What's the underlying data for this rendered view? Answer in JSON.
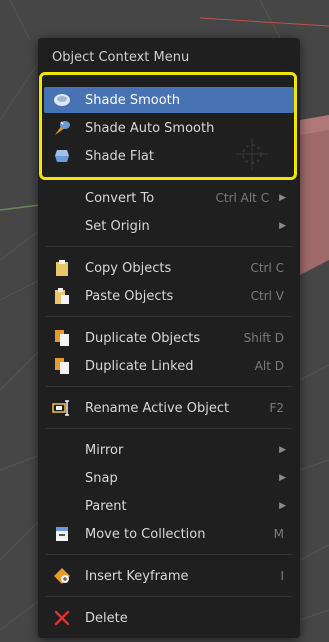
{
  "menu": {
    "title": "Object Context Menu",
    "items": [
      {
        "label": "Shade Smooth",
        "shortcut": "",
        "icon": "sphere-smooth-icon",
        "active": true
      },
      {
        "label": "Shade Auto Smooth",
        "shortcut": "",
        "icon": "auto-smooth-icon"
      },
      {
        "label": "Shade Flat",
        "shortcut": "",
        "icon": "sphere-flat-icon"
      },
      {
        "label": "Convert To",
        "shortcut": "Ctrl Alt C",
        "submenu": true
      },
      {
        "label": "Set Origin",
        "shortcut": "",
        "submenu": true
      },
      {
        "label": "Copy Objects",
        "shortcut": "Ctrl C",
        "icon": "copy-icon"
      },
      {
        "label": "Paste Objects",
        "shortcut": "Ctrl V",
        "icon": "paste-icon"
      },
      {
        "label": "Duplicate Objects",
        "shortcut": "Shift D",
        "icon": "duplicate-icon"
      },
      {
        "label": "Duplicate Linked",
        "shortcut": "Alt D",
        "icon": "duplicate-linked-icon"
      },
      {
        "label": "Rename Active Object",
        "shortcut": "F2",
        "icon": "rename-icon"
      },
      {
        "label": "Mirror",
        "shortcut": "",
        "submenu": true
      },
      {
        "label": "Snap",
        "shortcut": "",
        "submenu": true
      },
      {
        "label": "Parent",
        "shortcut": "",
        "submenu": true
      },
      {
        "label": "Move to Collection",
        "shortcut": "M",
        "icon": "collection-icon"
      },
      {
        "label": "Insert Keyframe",
        "shortcut": "I",
        "icon": "keyframe-icon"
      },
      {
        "label": "Delete",
        "shortcut": "",
        "icon": "delete-icon"
      }
    ]
  },
  "colors": {
    "menu_bg": "#1f1f1f",
    "active_bg": "#4772b3",
    "highlight_frame": "#f2e600",
    "shortcut_text": "#7b7b7b",
    "delete_icon": "#e03030"
  }
}
